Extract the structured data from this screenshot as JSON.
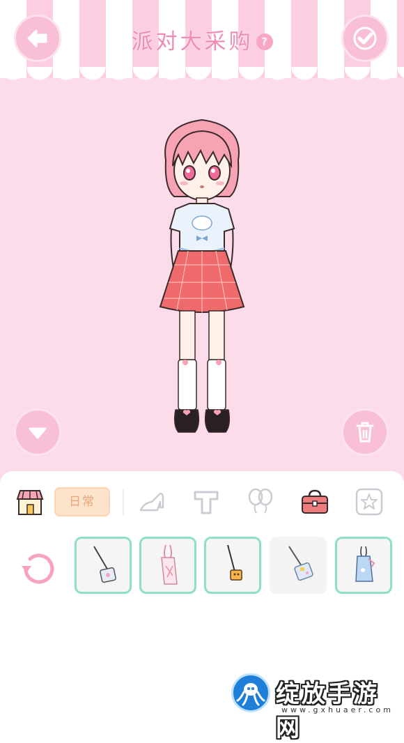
{
  "header": {
    "title": "派对大采购",
    "help_label": "?"
  },
  "icons": {
    "back": "arrow-left-icon",
    "confirm": "check-icon",
    "collapse": "chevron-down-icon",
    "delete": "trash-icon",
    "refresh": "refresh-icon"
  },
  "categories": {
    "selected_tag": "日常",
    "items": [
      "shop-icon",
      "high-heel-icon",
      "top-icon",
      "balloon-icon",
      "bag-icon",
      "star-icon"
    ]
  },
  "items": [
    {
      "icon": "crossbody-bag-icon",
      "selected": true
    },
    {
      "icon": "tote-bag-icon",
      "selected": true
    },
    {
      "icon": "small-yellow-bag-icon",
      "selected": true
    },
    {
      "icon": "patterned-bag-icon",
      "selected": false
    },
    {
      "icon": "blue-bag-icon",
      "selected": true
    }
  ],
  "watermark": {
    "name": "绽放手游网",
    "url": "www.gxhuaer.com"
  },
  "colors": {
    "background_pink": "#fcdbea",
    "button_pink": "#f9bfd6",
    "title_pink": "#f08bb6",
    "selected_border": "#8de0c6",
    "tag_bg": "#fde3cc"
  }
}
